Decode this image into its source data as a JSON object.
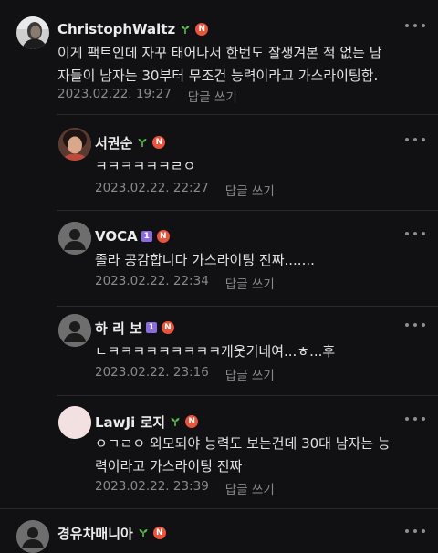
{
  "comments": [
    {
      "author": "ChristophWaltz",
      "text_lines": [
        "이게 팩트인데 자꾸 태어나서 한번도 잘생겨본 적 없는 남",
        "자들이 남자는 30부터 무조건 능력이라고 가스라이팅함."
      ],
      "time": "2023.02.22. 19:27",
      "reply_label": "답글 쓰기",
      "badges": [
        "sprout",
        "N"
      ],
      "avatar": "portrait-photo"
    },
    {
      "author": "서권순",
      "text_lines": [
        "ㅋㅋㅋㅋㅋㅋㄹㅇ"
      ],
      "time": "2023.02.22. 22:27",
      "reply_label": "답글 쓰기",
      "badges": [
        "sprout",
        "N"
      ],
      "avatar": "portrait-photo"
    },
    {
      "author": "VOCA",
      "text_lines": [
        "졸라 공감합니다 가스라이팅 진짜......."
      ],
      "time": "2023.02.22. 22:34",
      "reply_label": "답글 쓰기",
      "badges": [
        "1",
        "N"
      ],
      "avatar": "default-avatar"
    },
    {
      "author": "하 리 보",
      "text_lines": [
        "ㄴㅋㅋㅋㅋㅋㅋㅋㅋㅋ개웃기네여...ㅎ...후"
      ],
      "time": "2023.02.22. 23:16",
      "reply_label": "답글 쓰기",
      "badges": [
        "1",
        "N"
      ],
      "avatar": "default-avatar"
    },
    {
      "author": "LawJi 로지",
      "text_lines": [
        "ㅇㄱㄹㅇ 외모되야 능력도 보는건데 30대 남자는 능",
        "력이라고 가스라이팅 진짜"
      ],
      "time": "2023.02.22. 23:39",
      "reply_label": "답글 쓰기",
      "badges": [
        "sprout",
        "N"
      ],
      "avatar": "pink-avatar"
    },
    {
      "author": "경유차매니아",
      "text_lines": [],
      "time": "",
      "reply_label": "",
      "badges": [
        "sprout",
        "N"
      ],
      "avatar": "default-avatar"
    }
  ],
  "badge_n_label": "N",
  "badge_level_label": "1",
  "colors": {
    "background": "#111113",
    "text": "#e2e2e2",
    "meta": "#8a8a8a",
    "badge_n": "#e8543c",
    "badge_level": "#8b6be0",
    "sprout": "#5bbf4a"
  }
}
